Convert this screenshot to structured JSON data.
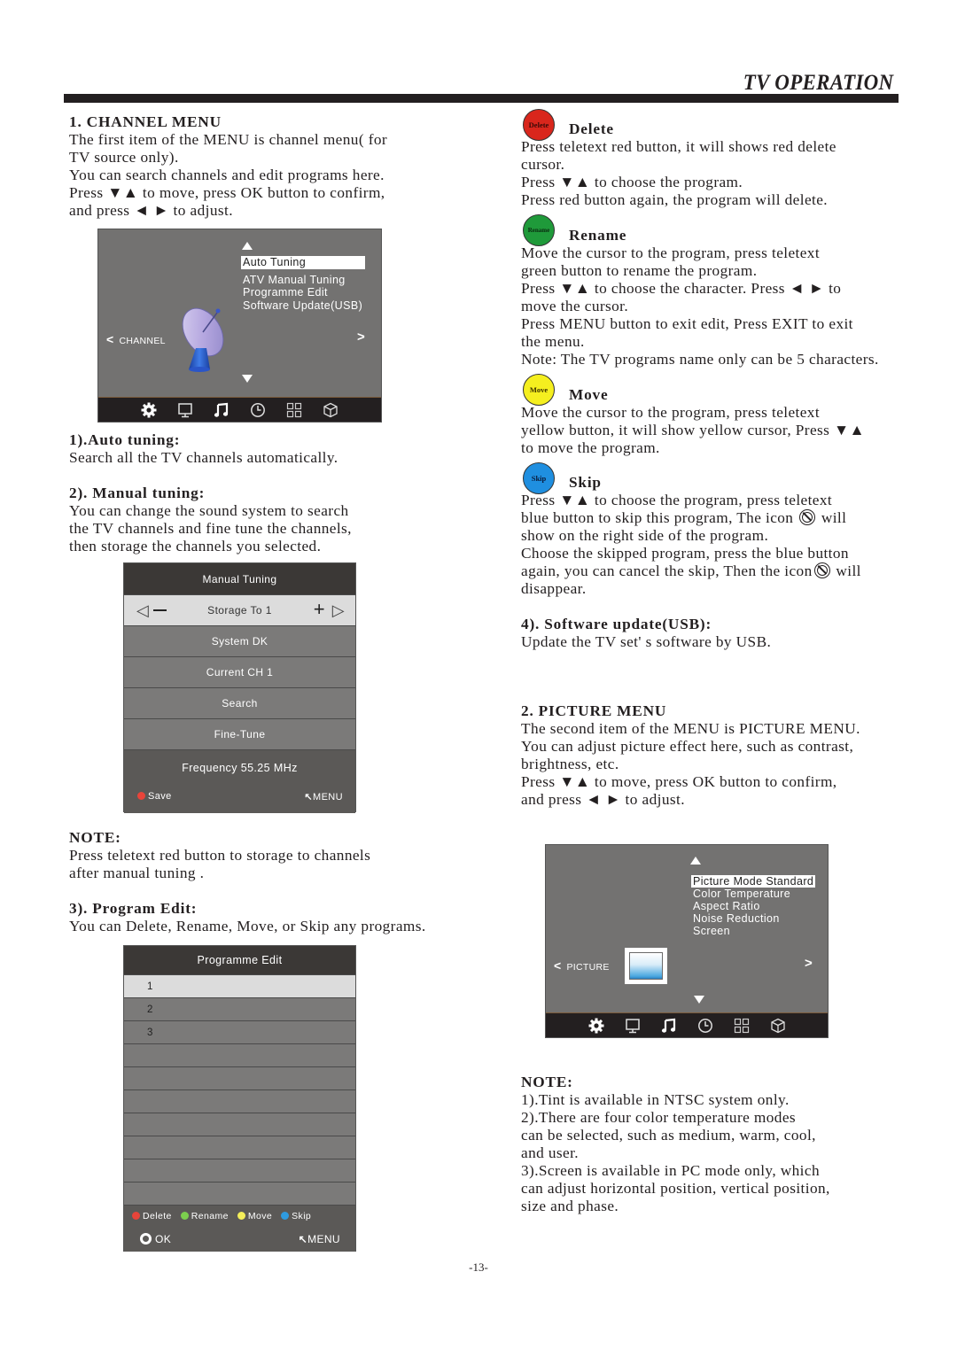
{
  "header": {
    "title": "TV OPERATION"
  },
  "left": {
    "channel_menu": {
      "heading": "1. CHANNEL MENU",
      "lines": [
        "The first item of the MENU is channel menu( for",
        "TV source only).",
        "You can search channels and edit programs here.",
        "Press ▼▲ to move, press OK button to confirm,",
        "and press ◄ ► to adjust."
      ]
    },
    "channel_osd": {
      "label": "CHANNEL",
      "items": [
        "Auto Tuning",
        "ATV Manual Tuning",
        "Programme Edit",
        "Software Update(USB)"
      ],
      "selected_item": "Auto Tuning",
      "tab_icons": [
        "gear-icon",
        "monitor-icon",
        "music-note-icon",
        "clock-icon",
        "grid-icon",
        "cube-icon"
      ]
    },
    "auto_tuning": {
      "heading": "1).Auto tuning:",
      "text": "Search all the TV channels automatically."
    },
    "manual_tuning": {
      "heading": "2). Manual tuning:",
      "lines": [
        "You can change the sound system to search",
        "the TV channels and fine tune the channels,",
        "then storage the channels you selected."
      ]
    },
    "manual_tuning_panel": {
      "title": "Manual Tuning",
      "rows": [
        "Storage To 1",
        "System DK",
        "Current CH 1",
        "Search",
        "Fine-Tune"
      ],
      "frequency": "Frequency  55.25  MHz",
      "save_label": "Save",
      "menu_label": "MENU"
    },
    "note": {
      "heading": "NOTE:",
      "lines": [
        "Press teletext red button to storage to channels",
        "after manual tuning ."
      ]
    },
    "program_edit": {
      "heading": "3). Program Edit:",
      "text": "You can Delete, Rename, Move, or Skip any programs."
    },
    "programme_edit_panel": {
      "title": "Programme Edit",
      "rows": [
        "1",
        "2",
        "3",
        "",
        "",
        "",
        "",
        "",
        "",
        ""
      ],
      "legend": [
        {
          "label": "Delete",
          "color": "#e8443a"
        },
        {
          "label": "Rename",
          "color": "#7ccf4e"
        },
        {
          "label": "Move",
          "color": "#f4ee5a"
        },
        {
          "label": "Skip",
          "color": "#2f9be0"
        }
      ],
      "ok_label": "OK",
      "menu_label": "MENU"
    }
  },
  "right": {
    "delete": {
      "badge": "Delete",
      "badge_color": "#d9261c",
      "heading": "Delete",
      "lines": [
        "Press teletext red button, it will shows red delete",
        "cursor.",
        "Press  ▼▲  to choose the program.",
        "Press red button again, the program will delete."
      ]
    },
    "rename": {
      "badge": "Rename",
      "badge_color": "#1f9a3a",
      "heading": "Rename",
      "lines": [
        "Move the cursor to the program, press teletext",
        "green button to rename the program.",
        "Press  ▼▲  to choose the character. Press ◄ ► to",
        "move the cursor.",
        "Press MENU button to exit edit, Press EXIT to exit",
        "the menu.",
        "Note: The TV programs name only can be 5 characters."
      ]
    },
    "move": {
      "badge": "Move",
      "badge_color": "#f5ef1f",
      "heading": "Move",
      "lines": [
        "Move the cursor to the program, press teletext",
        "yellow button, it will show yellow cursor, Press ▼▲",
        "to move the program."
      ]
    },
    "skip": {
      "badge": "Skip",
      "badge_color": "#1f8fe0",
      "heading": "Skip",
      "line1": "Press ▼▲ to choose the program, press teletext",
      "line2a": "blue button to skip this program, The icon",
      "line2b": "will",
      "line3": "show on the right side of the program.",
      "line4": "Choose the skipped program, press the blue button",
      "line5a": "again, you can cancel the skip, Then the icon",
      "line5b": "will",
      "line6": "disappear."
    },
    "software_update": {
      "heading": "4). Software update(USB):",
      "text": "Update the TV set' s software by USB."
    },
    "picture_menu": {
      "heading": "2. PICTURE MENU",
      "lines": [
        "The second item of the MENU is PICTURE MENU.",
        "You can adjust picture effect here, such as contrast,",
        "brightness, etc.",
        "Press ▼▲ to move, press OK button to confirm,",
        "and press ◄ ► to adjust."
      ]
    },
    "picture_osd": {
      "label": "PICTURE",
      "items": [
        "Picture Mode Standard",
        "Color Temperature",
        "Aspect Ratio",
        "Noise Reduction",
        "Screen"
      ],
      "selected_item": "Picture Mode Standard",
      "tab_icons": [
        "gear-icon",
        "monitor-icon",
        "music-note-icon",
        "clock-icon",
        "grid-icon",
        "cube-icon"
      ]
    },
    "note": {
      "heading": "NOTE:",
      "lines": [
        "1).Tint is available in NTSC system only.",
        "2).There are four color temperature modes",
        "can be selected, such as medium, warm, cool,",
        "and user.",
        "3).Screen is available in PC mode only, which",
        "can adjust horizontal position, vertical position,",
        "size and phase."
      ]
    }
  },
  "footer": {
    "page_number": "-13-"
  }
}
